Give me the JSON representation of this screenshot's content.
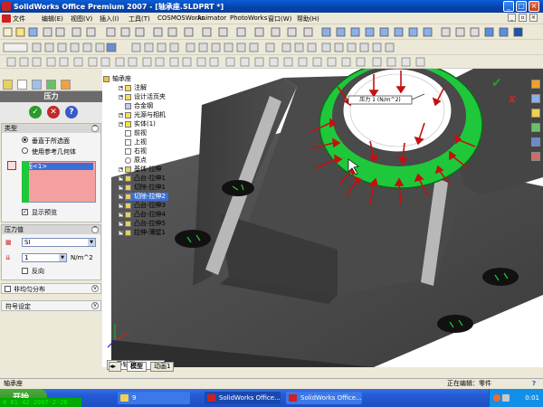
{
  "window": {
    "title": "SolidWorks Office Premium 2007 - [轴承座.SLDPRT *]"
  },
  "menu": {
    "items": [
      "文件",
      "编辑(E)",
      "视图(V)",
      "插入(I)",
      "工具(T)",
      "COSMOSWorks",
      "Animator",
      "PhotoWorks",
      "窗口(W)",
      "帮助(H)"
    ]
  },
  "property_manager": {
    "title": "压力",
    "type_section": {
      "header": "类型",
      "option1": "垂直于所选面",
      "option2": "使用参考几何体",
      "selection_item": "面<1>",
      "show_preview": "显示预览"
    },
    "pressure_section": {
      "header": "压力值",
      "unit_system": "SI",
      "value": "1",
      "unit": "N/m^2",
      "reverse": "反向"
    },
    "nonuniform_section": {
      "header": "非均匀分布"
    },
    "symbol_section": {
      "header": "符号设定"
    }
  },
  "tree": {
    "items": [
      {
        "label": "轴承座"
      },
      {
        "label": "注解"
      },
      {
        "label": "设计活页夹"
      },
      {
        "label": "合金钢"
      },
      {
        "label": "光源与相机"
      },
      {
        "label": "实体(1)"
      },
      {
        "label": "前视"
      },
      {
        "label": "上视"
      },
      {
        "label": "右视"
      },
      {
        "label": "原点"
      },
      {
        "label": "基体-拉伸"
      },
      {
        "label": "凸台-拉伸1"
      },
      {
        "label": "切除-拉伸1"
      },
      {
        "label": "切除-拉伸2"
      },
      {
        "label": "凸台-拉伸3"
      },
      {
        "label": "凸台-拉伸4"
      },
      {
        "label": "凸台-拉伸5"
      },
      {
        "label": "拉伸-薄壁1"
      }
    ]
  },
  "viewport": {
    "callout": "压力 1 (N/m^2)",
    "view_label": "*等轴测",
    "tabs": [
      "模型",
      "动画1"
    ]
  },
  "statusbar": {
    "left": "轴承座",
    "editing": "正在编辑：零件",
    "help": "?"
  },
  "taskbar": {
    "start": "开始",
    "clock_overlay": "0 01 42 2007-2-26",
    "tasks": [
      "9",
      "SolidWorks Office...",
      "SolidWorks Office..."
    ],
    "time": "0:01"
  },
  "colors": {
    "accent_green": "#1fc83a",
    "part_gray": "#4a4a4a",
    "arrow_red": "#c41010",
    "title_blue": "#0a5fd8"
  }
}
